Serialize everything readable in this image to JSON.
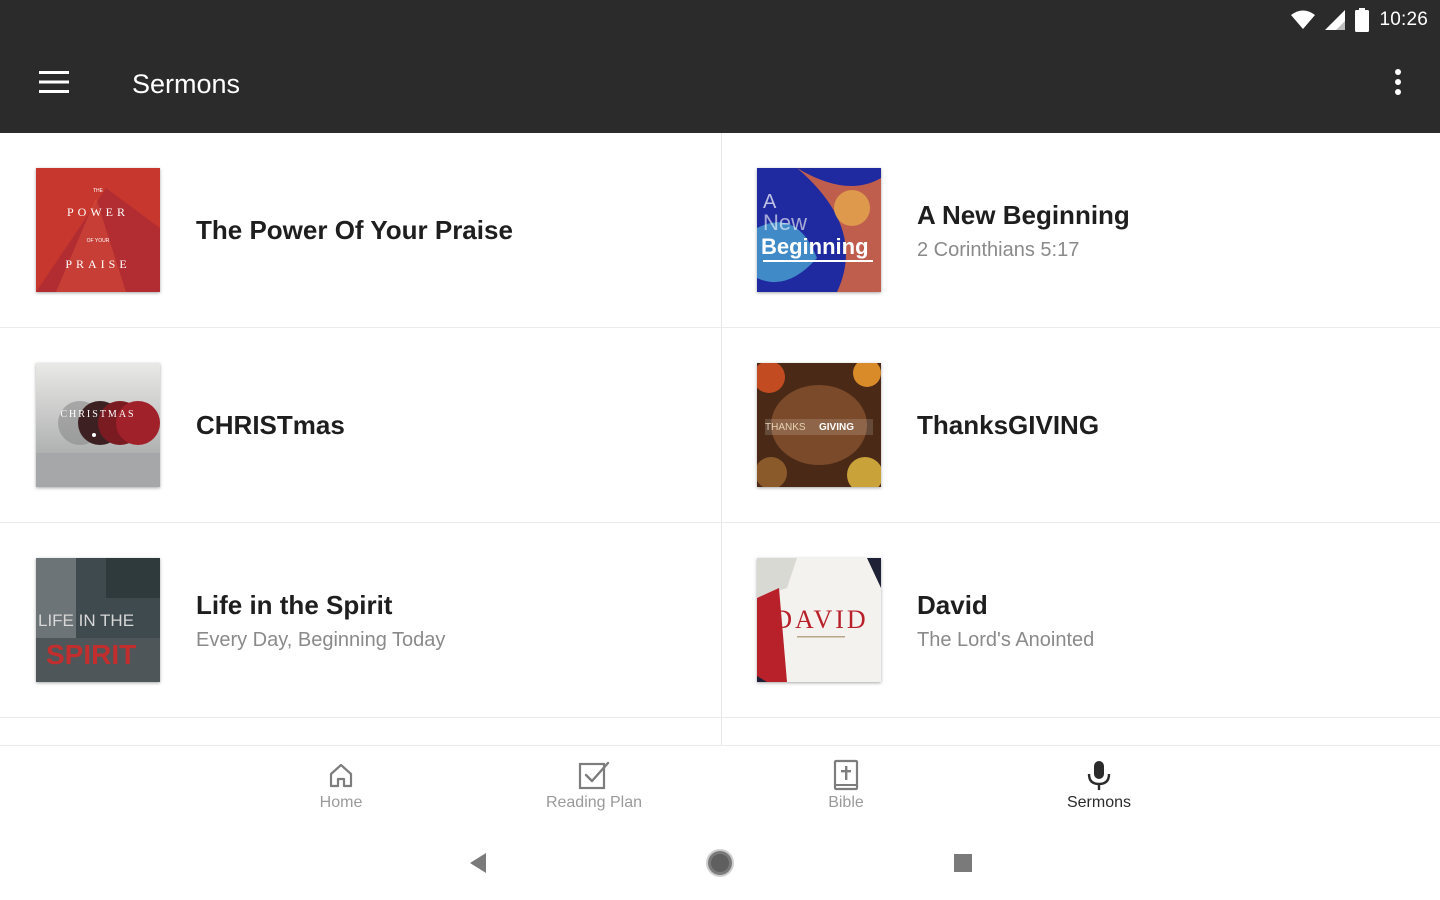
{
  "status_bar": {
    "time": "10:26",
    "icons": [
      "wifi-icon",
      "cell-signal-icon",
      "battery-icon"
    ]
  },
  "app_bar": {
    "title": "Sermons",
    "menu_icon": "hamburger-menu-icon",
    "overflow_icon": "more-vertical-icon"
  },
  "sermons": [
    {
      "title": "The Power Of Your Praise",
      "subtitle": "",
      "art_text": [
        "THE",
        "POWER",
        "OF YOUR",
        "PRAISE"
      ],
      "art_color": "#c8372d"
    },
    {
      "title": "A New Beginning",
      "subtitle": "2 Corinthians 5:17",
      "art_text": [
        "A",
        "New",
        "Beginning"
      ],
      "art_color": "#2233a6"
    },
    {
      "title": "CHRISTmas",
      "subtitle": "",
      "art_text": [
        "CHRISTMAS"
      ],
      "art_color": "#a0212a"
    },
    {
      "title": "ThanksGIVING",
      "subtitle": "",
      "art_text": [
        "THANKS",
        "GIVING"
      ],
      "art_color": "#6b3f22"
    },
    {
      "title": "Life in the Spirit",
      "subtitle": "Every Day, Beginning Today",
      "art_text": [
        "LIFE IN THE",
        "SPIRIT"
      ],
      "art_color": "#c22d2d"
    },
    {
      "title": "David",
      "subtitle": "The Lord's Anointed",
      "art_text": [
        "DAVID"
      ],
      "art_color": "#b8202a"
    }
  ],
  "bottom_nav": {
    "items": [
      {
        "label": "Home",
        "icon": "home-icon"
      },
      {
        "label": "Reading Plan",
        "icon": "checkbox-icon"
      },
      {
        "label": "Bible",
        "icon": "bible-icon"
      },
      {
        "label": "Sermons",
        "icon": "microphone-icon"
      }
    ],
    "active": "Sermons"
  },
  "system_nav": {
    "icons": [
      "back-triangle-icon",
      "home-circle-icon",
      "recents-square-icon"
    ]
  }
}
